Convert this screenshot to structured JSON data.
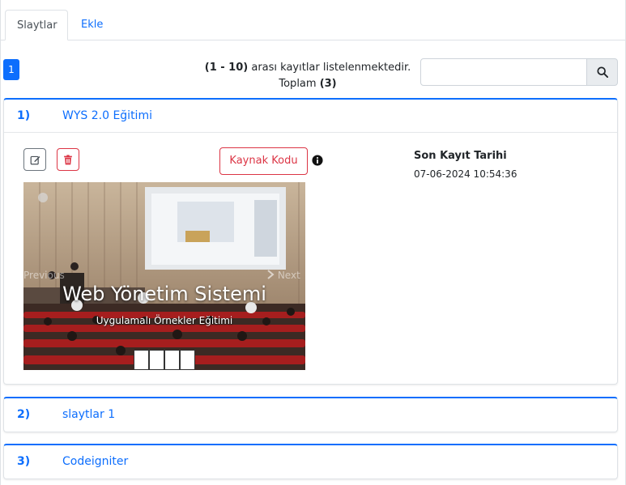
{
  "tabs": [
    {
      "label": "Slaytlar",
      "active": true
    },
    {
      "label": "Ekle",
      "active": false
    }
  ],
  "pagination": {
    "current_page": "1"
  },
  "listing": {
    "range": "(1 - 10)",
    "range_suffix": " arası kayıtlar listelenmektedir.",
    "total_label": "Toplam ",
    "total_value": "(3)"
  },
  "search": {
    "placeholder": "",
    "value": "",
    "icon": "search-icon"
  },
  "records": [
    {
      "number": "1)",
      "title": "WYS 2.0 Eğitimi",
      "expanded": true,
      "source_button_label": "Kaynak Kodu",
      "last_saved_label": "Son Kayıt Tarihi",
      "last_saved_value": "07-06-2024 10:54:36",
      "carousel": {
        "prev_label": "Previous",
        "next_label": "Next",
        "caption_title": "Web Yönetim Sistemi",
        "caption_subtitle": "Uygulamalı Örnekler Eğitimi",
        "slide_count": 4
      }
    },
    {
      "number": "2)",
      "title": "slaytlar 1",
      "expanded": false
    },
    {
      "number": "3)",
      "title": "Codeigniter",
      "expanded": false
    }
  ],
  "colors": {
    "primary": "#0d6efd",
    "danger": "#dc3545",
    "secondary": "#6c757d"
  }
}
